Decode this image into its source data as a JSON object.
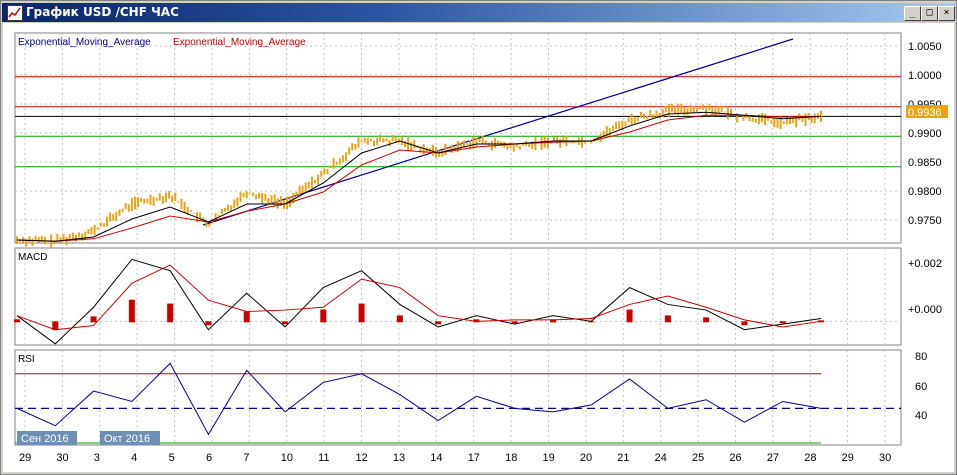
{
  "window": {
    "title": "График USD /CHF  ЧАС",
    "minimize": "_",
    "maximize": "□",
    "close": "×"
  },
  "legend": {
    "ema_black": "Exponential_Moving_Average",
    "ema_red": "Exponential_Moving_Average"
  },
  "panels": {
    "macd_label": "MACD",
    "rsi_label": "RSI"
  },
  "price_axis": [
    "1.0050",
    "1.0000",
    "0.9950",
    "0.9900",
    "0.9850",
    "0.9800",
    "0.9750"
  ],
  "current_price": "0.9936",
  "macd_axis": [
    "+0.002",
    "+0.000"
  ],
  "rsi_axis": [
    "80",
    "60",
    "40"
  ],
  "month_labels": [
    "Сен 2016",
    "Окт 2016"
  ],
  "date_axis": [
    "29",
    "30",
    "3",
    "4",
    "5",
    "6",
    "7",
    "10",
    "11",
    "12",
    "13",
    "14",
    "17",
    "18",
    "19",
    "20",
    "21",
    "24",
    "25",
    "26",
    "27",
    "28",
    "29",
    "30"
  ],
  "colors": {
    "candles": "#e8a317",
    "ema_fast": "#000000",
    "ema_slow": "#cc0000",
    "trendline": "#00008b",
    "resistance": "#cc0000",
    "support": "#00a000",
    "rsi_line": "#00008b",
    "macd_hist": "#cc0000",
    "grid": "#c0c0c0"
  },
  "chart_data": [
    {
      "type": "line",
      "title": "",
      "xlabel": "",
      "ylabel": "",
      "ylim": [
        0.9725,
        1.0075
      ],
      "x": [
        "29",
        "30",
        "3",
        "4",
        "5",
        "6",
        "7",
        "10",
        "11",
        "12",
        "13",
        "14",
        "17",
        "18",
        "19",
        "20",
        "21",
        "24",
        "25",
        "26",
        "27",
        "28"
      ],
      "series": [
        {
          "name": "",
          "values": [
            0.973,
            0.9728,
            0.9745,
            0.979,
            0.9805,
            0.9755,
            0.981,
            0.979,
            0.984,
            0.9895,
            0.9895,
            0.9875,
            0.9895,
            0.9885,
            0.9895,
            0.9895,
            0.993,
            0.9945,
            0.995,
            0.9935,
            0.9925,
            0.9936
          ]
        },
        {
          "name": "Exponential_Moving_Average",
          "values": [
            0.973,
            0.9728,
            0.9735,
            0.9765,
            0.9785,
            0.976,
            0.979,
            0.979,
            0.9825,
            0.9875,
            0.9895,
            0.9875,
            0.989,
            0.989,
            0.9895,
            0.9895,
            0.992,
            0.994,
            0.9943,
            0.9938,
            0.9932,
            0.9936
          ]
        },
        {
          "name": "Exponential_Moving_Average",
          "values": [
            0.973,
            0.9728,
            0.9732,
            0.975,
            0.977,
            0.976,
            0.9778,
            0.979,
            0.981,
            0.9855,
            0.988,
            0.9875,
            0.9885,
            0.989,
            0.9893,
            0.9895,
            0.991,
            0.993,
            0.9938,
            0.9938,
            0.9935,
            0.9936
          ]
        }
      ],
      "horizontal_lines": [
        1.0002,
        0.9952,
        0.9936,
        0.9903,
        0.9852
      ]
    },
    {
      "type": "bar",
      "title": "MACD",
      "x": [
        "29",
        "30",
        "3",
        "4",
        "5",
        "6",
        "7",
        "10",
        "11",
        "12",
        "13",
        "14",
        "17",
        "18",
        "19",
        "20",
        "21",
        "24",
        "25",
        "26",
        "27",
        "28"
      ],
      "values": [
        0.0002,
        -0.0008,
        0.0005,
        0.0022,
        0.0018,
        -0.0003,
        0.001,
        -0.0002,
        0.0012,
        0.0018,
        0.0006,
        -0.0002,
        0.0002,
        -0.0001,
        0.0002,
        0.0,
        0.0012,
        0.0006,
        0.0004,
        -0.0003,
        -0.0001,
        0.0001
      ],
      "ylim": [
        -0.0007,
        0.0025
      ]
    },
    {
      "type": "line",
      "title": "RSI",
      "x": [
        "29",
        "30",
        "3",
        "4",
        "5",
        "6",
        "7",
        "10",
        "11",
        "12",
        "13",
        "14",
        "17",
        "18",
        "19",
        "20",
        "21",
        "24",
        "25",
        "26",
        "27",
        "28"
      ],
      "values": [
        50,
        40,
        60,
        54,
        76,
        35,
        72,
        48,
        65,
        70,
        58,
        43,
        57,
        50,
        48,
        52,
        67,
        50,
        55,
        42,
        54,
        50
      ],
      "ylim": [
        30,
        82
      ],
      "levels": [
        70,
        50,
        30
      ]
    }
  ]
}
